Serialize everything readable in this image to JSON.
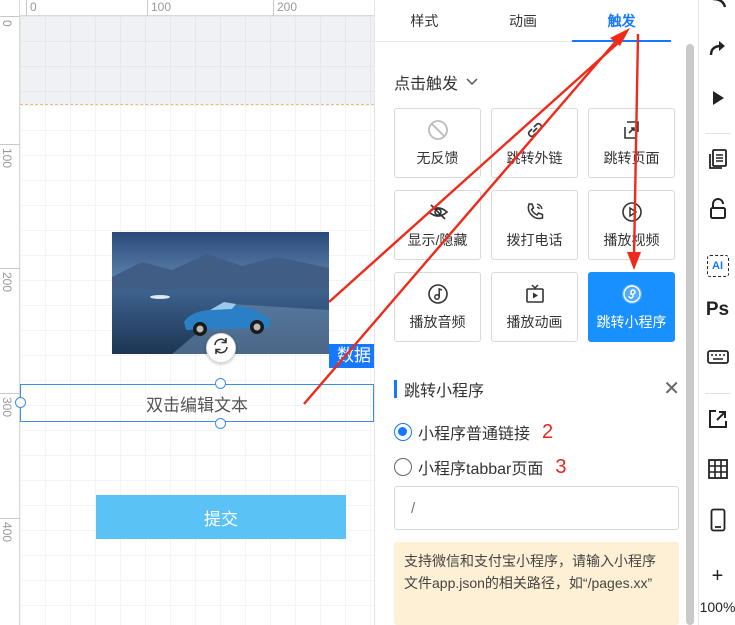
{
  "rulers": {
    "top_labels": [
      "0",
      "100",
      "200"
    ],
    "left_labels": [
      "0",
      "100",
      "200",
      "300",
      "400"
    ]
  },
  "canvas": {
    "refresh_icon": "refresh-icon",
    "data_tag": "数据",
    "text_placeholder": "双击编辑文本",
    "submit_label": "提交"
  },
  "panel": {
    "tabs": [
      {
        "label": "样式",
        "active": false
      },
      {
        "label": "动画",
        "active": false
      },
      {
        "label": "触发",
        "active": true
      }
    ],
    "trigger_select": "点击触发",
    "actions": [
      {
        "label": "无反馈",
        "icon": "no-feedback-icon",
        "selected": false
      },
      {
        "label": "跳转外链",
        "icon": "link-icon",
        "selected": false
      },
      {
        "label": "跳转页面",
        "icon": "page-jump-icon",
        "selected": false
      },
      {
        "label": "显示/隐藏",
        "icon": "eye-off-icon",
        "selected": false
      },
      {
        "label": "拨打电话",
        "icon": "phone-icon",
        "selected": false
      },
      {
        "label": "播放视频",
        "icon": "play-video-icon",
        "selected": false
      },
      {
        "label": "播放音频",
        "icon": "music-note-icon",
        "selected": false
      },
      {
        "label": "播放动画",
        "icon": "tv-play-icon",
        "selected": false
      },
      {
        "label": "跳转小程序",
        "icon": "mini-program-icon",
        "selected": true
      }
    ],
    "section_title": "跳转小程序",
    "close_icon": "close-icon",
    "radio_options": [
      {
        "label": "小程序普通链接",
        "annotation": "2",
        "checked": true
      },
      {
        "label": "小程序tabbar页面",
        "annotation": "3",
        "checked": false
      }
    ],
    "path_placeholder": "/",
    "notice_text": "支持微信和支付宝小程序，请输入小程序文件app.json的相关路径，如“/pages.xx”"
  },
  "toolbar": {
    "ps_label": "Ps",
    "ai_label": "AI",
    "zoom": "100%",
    "zoom_in": "+"
  },
  "colors": {
    "accent": "#1677ff",
    "submit": "#5ac2f5",
    "annotation_red": "#e8261c",
    "notice_bg": "#fdf0d4"
  }
}
